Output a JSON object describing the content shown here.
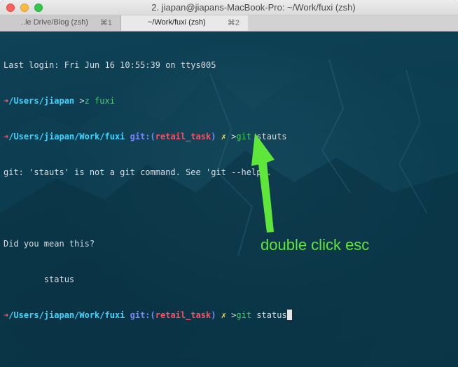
{
  "window": {
    "title": "2. jiapan@jiapans-MacBook-Pro: ~/Work/fuxi (zsh)"
  },
  "tabs": [
    {
      "label": "..le Drive/Blog (zsh)",
      "shortcut": "⌘1",
      "active": false
    },
    {
      "label": "~/Work/fuxi (zsh)",
      "shortcut": "⌘2",
      "active": true
    }
  ],
  "terminal": {
    "last_login": "Last login: Fri Jun 16 10:55:39 on ttys005",
    "prompt_arrow": "➜",
    "line1": {
      "path": "/Users/jiapan",
      "prompt": " >",
      "command": "z fuxi"
    },
    "line2": {
      "path": "/Users/jiapan/Work/fuxi",
      "git_prefix": " git:(",
      "branch": "retail_task",
      "git_suffix": ")",
      "dirty": " ✗",
      "prompt": " >",
      "command_git": "git",
      "command_rest": " stauts"
    },
    "error_line": "git: 'stauts' is not a git command. See 'git --help'.",
    "suggest_header": "Did you mean this?",
    "suggest_item": "        status",
    "line3": {
      "path": "/Users/jiapan/Work/fuxi",
      "git_prefix": " git:(",
      "branch": "retail_task",
      "git_suffix": ")",
      "dirty": " ✗",
      "prompt": " >",
      "command_git": "git",
      "command_rest": " status"
    }
  },
  "annotation": {
    "text": "double click esc",
    "color": "#5ee73a"
  },
  "colors": {
    "background": "#0c3a4c",
    "arrow_red": "#ff4f62",
    "path_cyan": "#3ed4ff",
    "git_blue": "#7b86ff",
    "dirty_yellow": "#f5e35a",
    "command_green": "#44d160"
  }
}
